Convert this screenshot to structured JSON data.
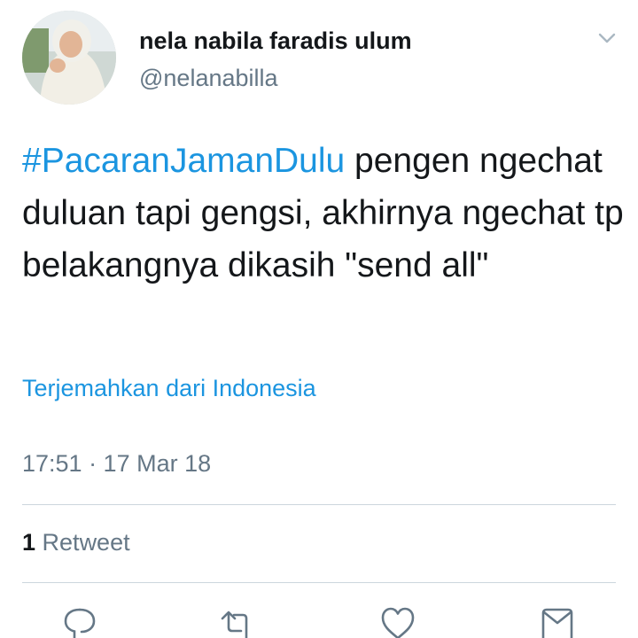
{
  "tweet": {
    "author": {
      "display_name": "nela nabila faradis ulum",
      "handle": "@nelanabilla"
    },
    "text": {
      "hashtag": "#PacaranJamanDulu",
      "body": " pengen ngechat duluan tapi gengsi, akhirnya ngechat tp belakangnya dikasih \"send all\""
    },
    "translate_label": "Terjemahkan dari Indonesia",
    "timestamp": "17:51 · 17 Mar 18",
    "stats": {
      "retweet_count": "1",
      "retweet_label": "Retweet"
    },
    "actions": {
      "icons": [
        "reply-icon",
        "retweet-icon",
        "like-icon",
        "direct-message-icon"
      ]
    }
  },
  "colors": {
    "accent": "#1b95e0",
    "text": "#14171a",
    "secondary_text": "#657786",
    "divider": "#ccd6dd",
    "icon": "#657786"
  }
}
